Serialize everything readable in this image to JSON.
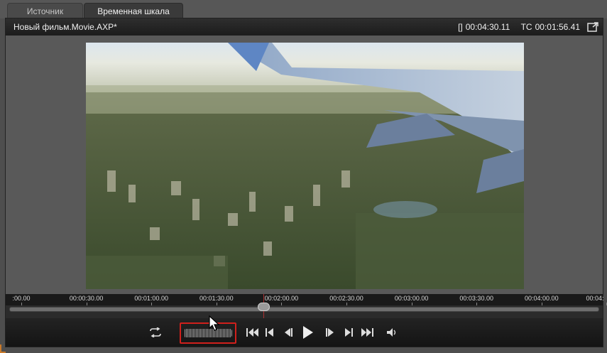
{
  "tabs": [
    {
      "label": "Источник",
      "active": false
    },
    {
      "label": "Временная шкала",
      "active": true
    }
  ],
  "titlebar": {
    "project_title": "Новый фильм.Movie.AXP*",
    "duration_label": "[]",
    "duration": "00:04:30.11",
    "tc_label": "TC",
    "tc": "00:01:56.41"
  },
  "timeline": {
    "ticks": [
      ":00.00",
      "00:00:30.00",
      "00:01:00.00",
      "00:01:30.00",
      "00:02:00.00",
      "00:02:30.00",
      "00:03:00.00",
      "00:03:30.00",
      "00:04:00.00",
      "00:04:"
    ],
    "playhead_time": "00:01:56.41"
  },
  "controls": {
    "icons": [
      "loop-icon",
      "jog-shuttle",
      "go-to-start-icon",
      "previous-mark-icon",
      "step-back-icon",
      "play-icon",
      "step-forward-icon",
      "next-mark-icon",
      "go-to-end-icon",
      "volume-icon"
    ]
  },
  "colors": {
    "highlight": "#d0201c",
    "panel": "#555555",
    "titlebar": "#1c1c1c"
  }
}
